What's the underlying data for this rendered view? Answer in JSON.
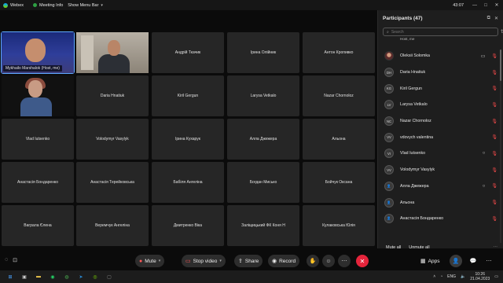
{
  "titlebar": {
    "app_name": "Webex",
    "meeting_info": "Meeting Info",
    "menu_bar": "Show Menu Bar",
    "timer": "43:07"
  },
  "tiles": [
    {
      "name": "Mykhailo Marshalok (Host, me)",
      "type": "video",
      "active": true
    },
    {
      "name": "",
      "type": "video"
    },
    {
      "name": "Андрій Ткачик"
    },
    {
      "name": "Ірина Олійник"
    },
    {
      "name": "Антон Кропивко"
    },
    {
      "name": "",
      "type": "video"
    },
    {
      "name": "Daria Hnatiuk"
    },
    {
      "name": "Kiril Gergun"
    },
    {
      "name": "Larysa Vetkalo"
    },
    {
      "name": "Nazar Chornoloz"
    },
    {
      "name": "Vlad Iutsenko"
    },
    {
      "name": "Volodymyr Vasylyk"
    },
    {
      "name": "Ірина Кухарук"
    },
    {
      "name": "Алла Джежера"
    },
    {
      "name": "Альона"
    },
    {
      "name": "Анастасія Бондаренко"
    },
    {
      "name": "Анастасія Терейковська"
    },
    {
      "name": "Бабiля Ангеліна"
    },
    {
      "name": "Богдан Мисько"
    },
    {
      "name": "Бойчук Оксана"
    },
    {
      "name": "Ваграла Єлена"
    },
    {
      "name": "Веремчук Ангеліна"
    },
    {
      "name": "Дмитренко Віка"
    },
    {
      "name": "Заліщицький ФК Коня Н"
    },
    {
      "name": "Кулаковська Юлія"
    }
  ],
  "controls": {
    "mute": "Mute",
    "stop_video": "Stop video",
    "share": "Share",
    "record": "Record",
    "apps": "Apps"
  },
  "participants": {
    "title": "Participants (47)",
    "search_placeholder": "Search",
    "host_partial": "Host, me",
    "list": [
      {
        "initials": "",
        "name": "Oleksii Solomka",
        "avatar": "img",
        "video": "on"
      },
      {
        "initials": "DH",
        "name": "Daria Hnatiuk",
        "video": "off"
      },
      {
        "initials": "KG",
        "name": "Kiril Gergun",
        "video": "off"
      },
      {
        "initials": "LV",
        "name": "Larysa Vetkalo",
        "video": "off"
      },
      {
        "initials": "NC",
        "name": "Nazar Chornoloz",
        "video": "off"
      },
      {
        "initials": "VV",
        "name": "vdovych valentina",
        "video": "off"
      },
      {
        "initials": "VI",
        "name": "Vlad Iutsenko",
        "video": "off",
        "chat": true
      },
      {
        "initials": "VV",
        "name": "Volodymyr Vasylyk",
        "video": "off"
      },
      {
        "initials": "",
        "name": "Алла Джежера",
        "avatar": "person",
        "video": "off",
        "chat": true
      },
      {
        "initials": "",
        "name": "Альона",
        "avatar": "person",
        "video": "off"
      },
      {
        "initials": "",
        "name": "Анастасія Бондаренко",
        "avatar": "person",
        "video": "off"
      }
    ],
    "mute_all": "Mute all",
    "unmute_all": "Unmute all"
  },
  "taskbar": {
    "lang": "ENG",
    "time": "10:26",
    "date": "21.04.2023"
  }
}
